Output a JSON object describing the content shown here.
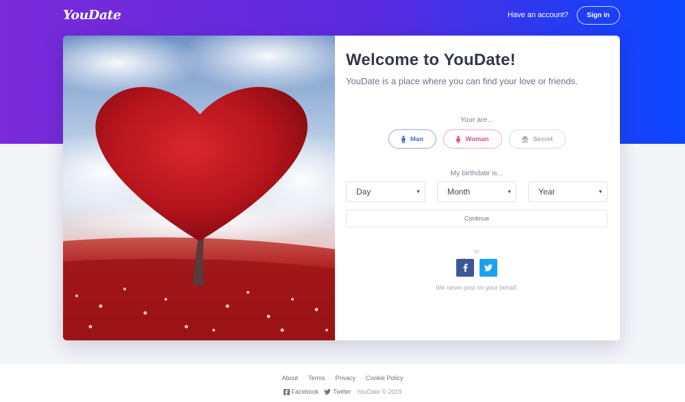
{
  "header": {
    "logo": "YouDate",
    "have_account": "Have an account?",
    "signin_label": "Sign in"
  },
  "hero_image": {
    "icon": "heart-tree-image"
  },
  "form": {
    "title": "Welcome to YouDate!",
    "subtitle": "YouDate is a place where you can find your love or friends.",
    "you_are_label": "Your are...",
    "genders": [
      {
        "label": "Man",
        "icon": "male-icon",
        "color": "#4a6fcc"
      },
      {
        "label": "Woman",
        "icon": "female-icon",
        "color": "#e0508d"
      },
      {
        "label": "Secret",
        "icon": "incognito-icon",
        "color": "#a8acb8"
      }
    ],
    "birthdate_label": "My birthdate is...",
    "day_value": "Day",
    "month_value": "Month",
    "year_value": "Year",
    "continue_label": "Continue",
    "or_label": "or",
    "never_post": "We never post on your behalf."
  },
  "footer": {
    "links": [
      "About",
      "Terms",
      "Privacy",
      "Cookie Policy"
    ],
    "facebook": "Facebook",
    "twitter": "Twitter",
    "copyright": "YouDate © 2019"
  },
  "colors": {
    "gradient_start": "#7a2ad8",
    "gradient_end": "#0d47ff",
    "facebook": "#3b5998",
    "twitter": "#1da1f2"
  }
}
